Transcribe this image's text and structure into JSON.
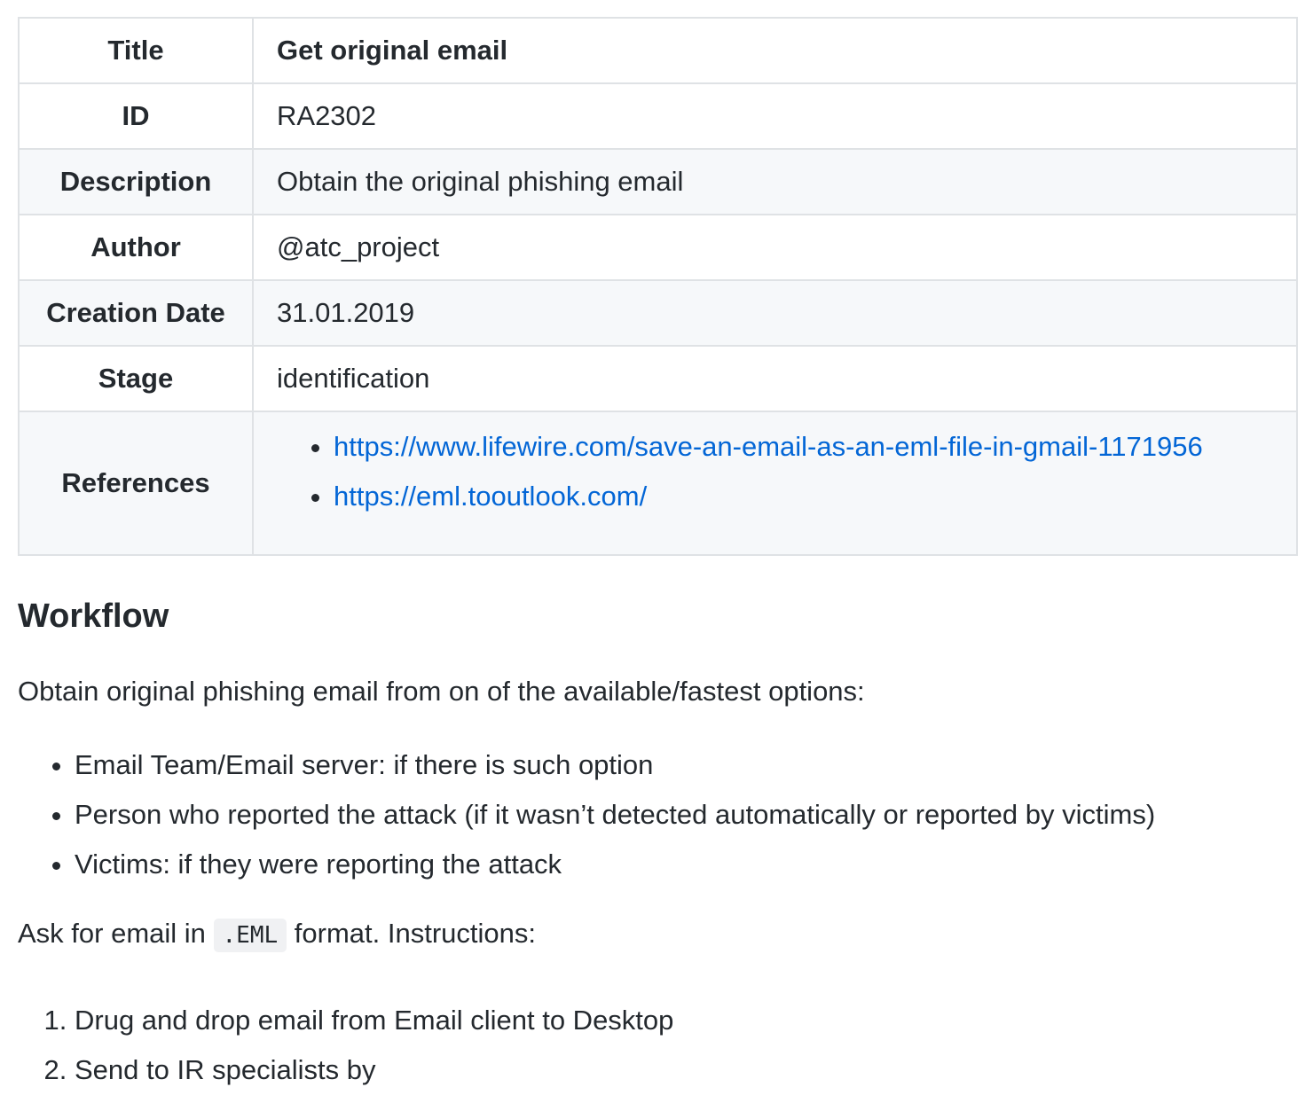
{
  "table": {
    "rows": [
      {
        "key": "Title",
        "value": "Get original email"
      },
      {
        "key": "ID",
        "value": "RA2302"
      },
      {
        "key": "Description",
        "value": "Obtain the original phishing email"
      },
      {
        "key": "Author",
        "value": "@atc_project"
      },
      {
        "key": "Creation Date",
        "value": "31.01.2019"
      },
      {
        "key": "Stage",
        "value": "identification"
      }
    ],
    "references_key": "References",
    "references": [
      "https://www.lifewire.com/save-an-email-as-an-eml-file-in-gmail-1171956",
      "https://eml.tooutlook.com/"
    ]
  },
  "workflow": {
    "heading": "Workflow",
    "intro": "Obtain original phishing email from on of the available/fastest options:",
    "options": [
      "Email Team/Email server: if there is such option",
      "Person who reported the attack (if it wasn’t detected automatically or reported by victims)",
      "Victims: if they were reporting the attack"
    ],
    "ask_prefix": "Ask for email in",
    "ask_code": ".EML",
    "ask_suffix": "format. Instructions:",
    "steps": [
      "Drug and drop email from Email client to Desktop",
      "Send to IR specialists by"
    ]
  }
}
